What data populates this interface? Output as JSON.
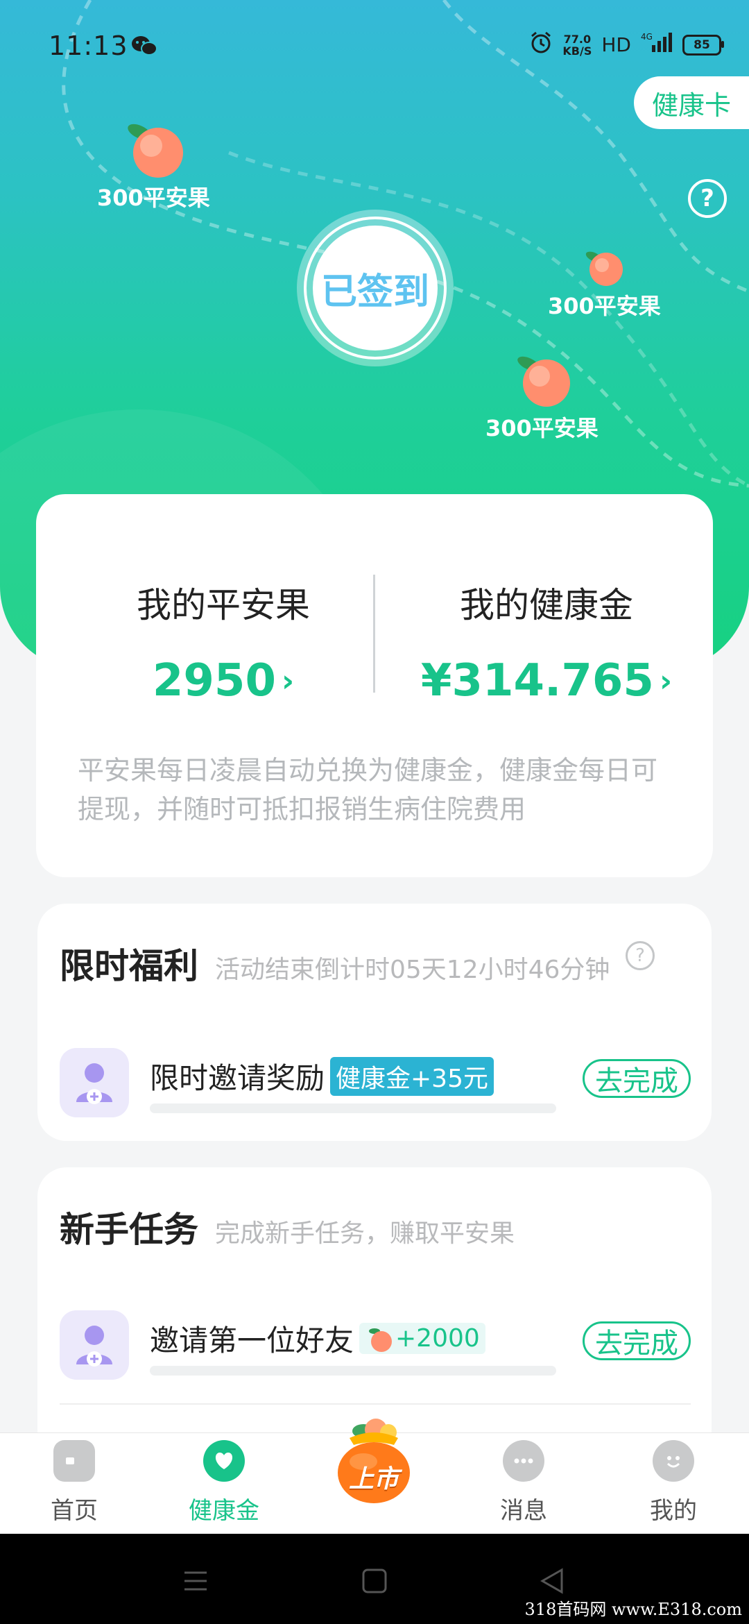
{
  "status_bar": {
    "time": "11:13",
    "net_speed_value": "77.0",
    "net_speed_unit": "KB/S",
    "hd": "HD",
    "network": "4G",
    "battery": "85"
  },
  "header": {
    "health_card_label": "健康卡",
    "help_icon": "question-circle-icon"
  },
  "fruits": [
    {
      "label": "300平安果"
    },
    {
      "label": "300平安果"
    },
    {
      "label": "300平安果"
    }
  ],
  "sign_in": {
    "label": "已签到"
  },
  "balance": {
    "peace_fruit_title": "我的平安果",
    "peace_fruit_value": "2950",
    "health_gold_title": "我的健康金",
    "health_gold_value": "¥314.765",
    "chevron": "›",
    "note": "平安果每日凌晨自动兑换为健康金，健康金每日可提现，并随时可抵扣报销生病住院费用"
  },
  "limited": {
    "title": "限时福利",
    "subtitle": "活动结束倒计时05天12小时46分钟",
    "help": "?",
    "task": {
      "name": "限时邀请奖励",
      "tag": "健康金+35元",
      "action": "去完成",
      "progress": 0
    }
  },
  "newbie": {
    "title": "新手任务",
    "subtitle": "完成新手任务，赚取平安果",
    "task": {
      "name": "邀请第一位好友",
      "reward": "+2000",
      "action": "去完成",
      "progress": 0
    }
  },
  "tabs": [
    {
      "label": "首页",
      "icon": "home-icon"
    },
    {
      "label": "健康金",
      "icon": "heart-icon"
    },
    {
      "label": "上市",
      "icon": "money-bag-icon"
    },
    {
      "label": "消息",
      "icon": "chat-bubble-icon"
    },
    {
      "label": "我的",
      "icon": "smile-face-icon"
    }
  ],
  "watermark": "318首码网 www.E318.com",
  "colors": {
    "accent": "#18c38a",
    "sign_text": "#5ec3f0",
    "tag_bg": "#2bb3d3"
  }
}
